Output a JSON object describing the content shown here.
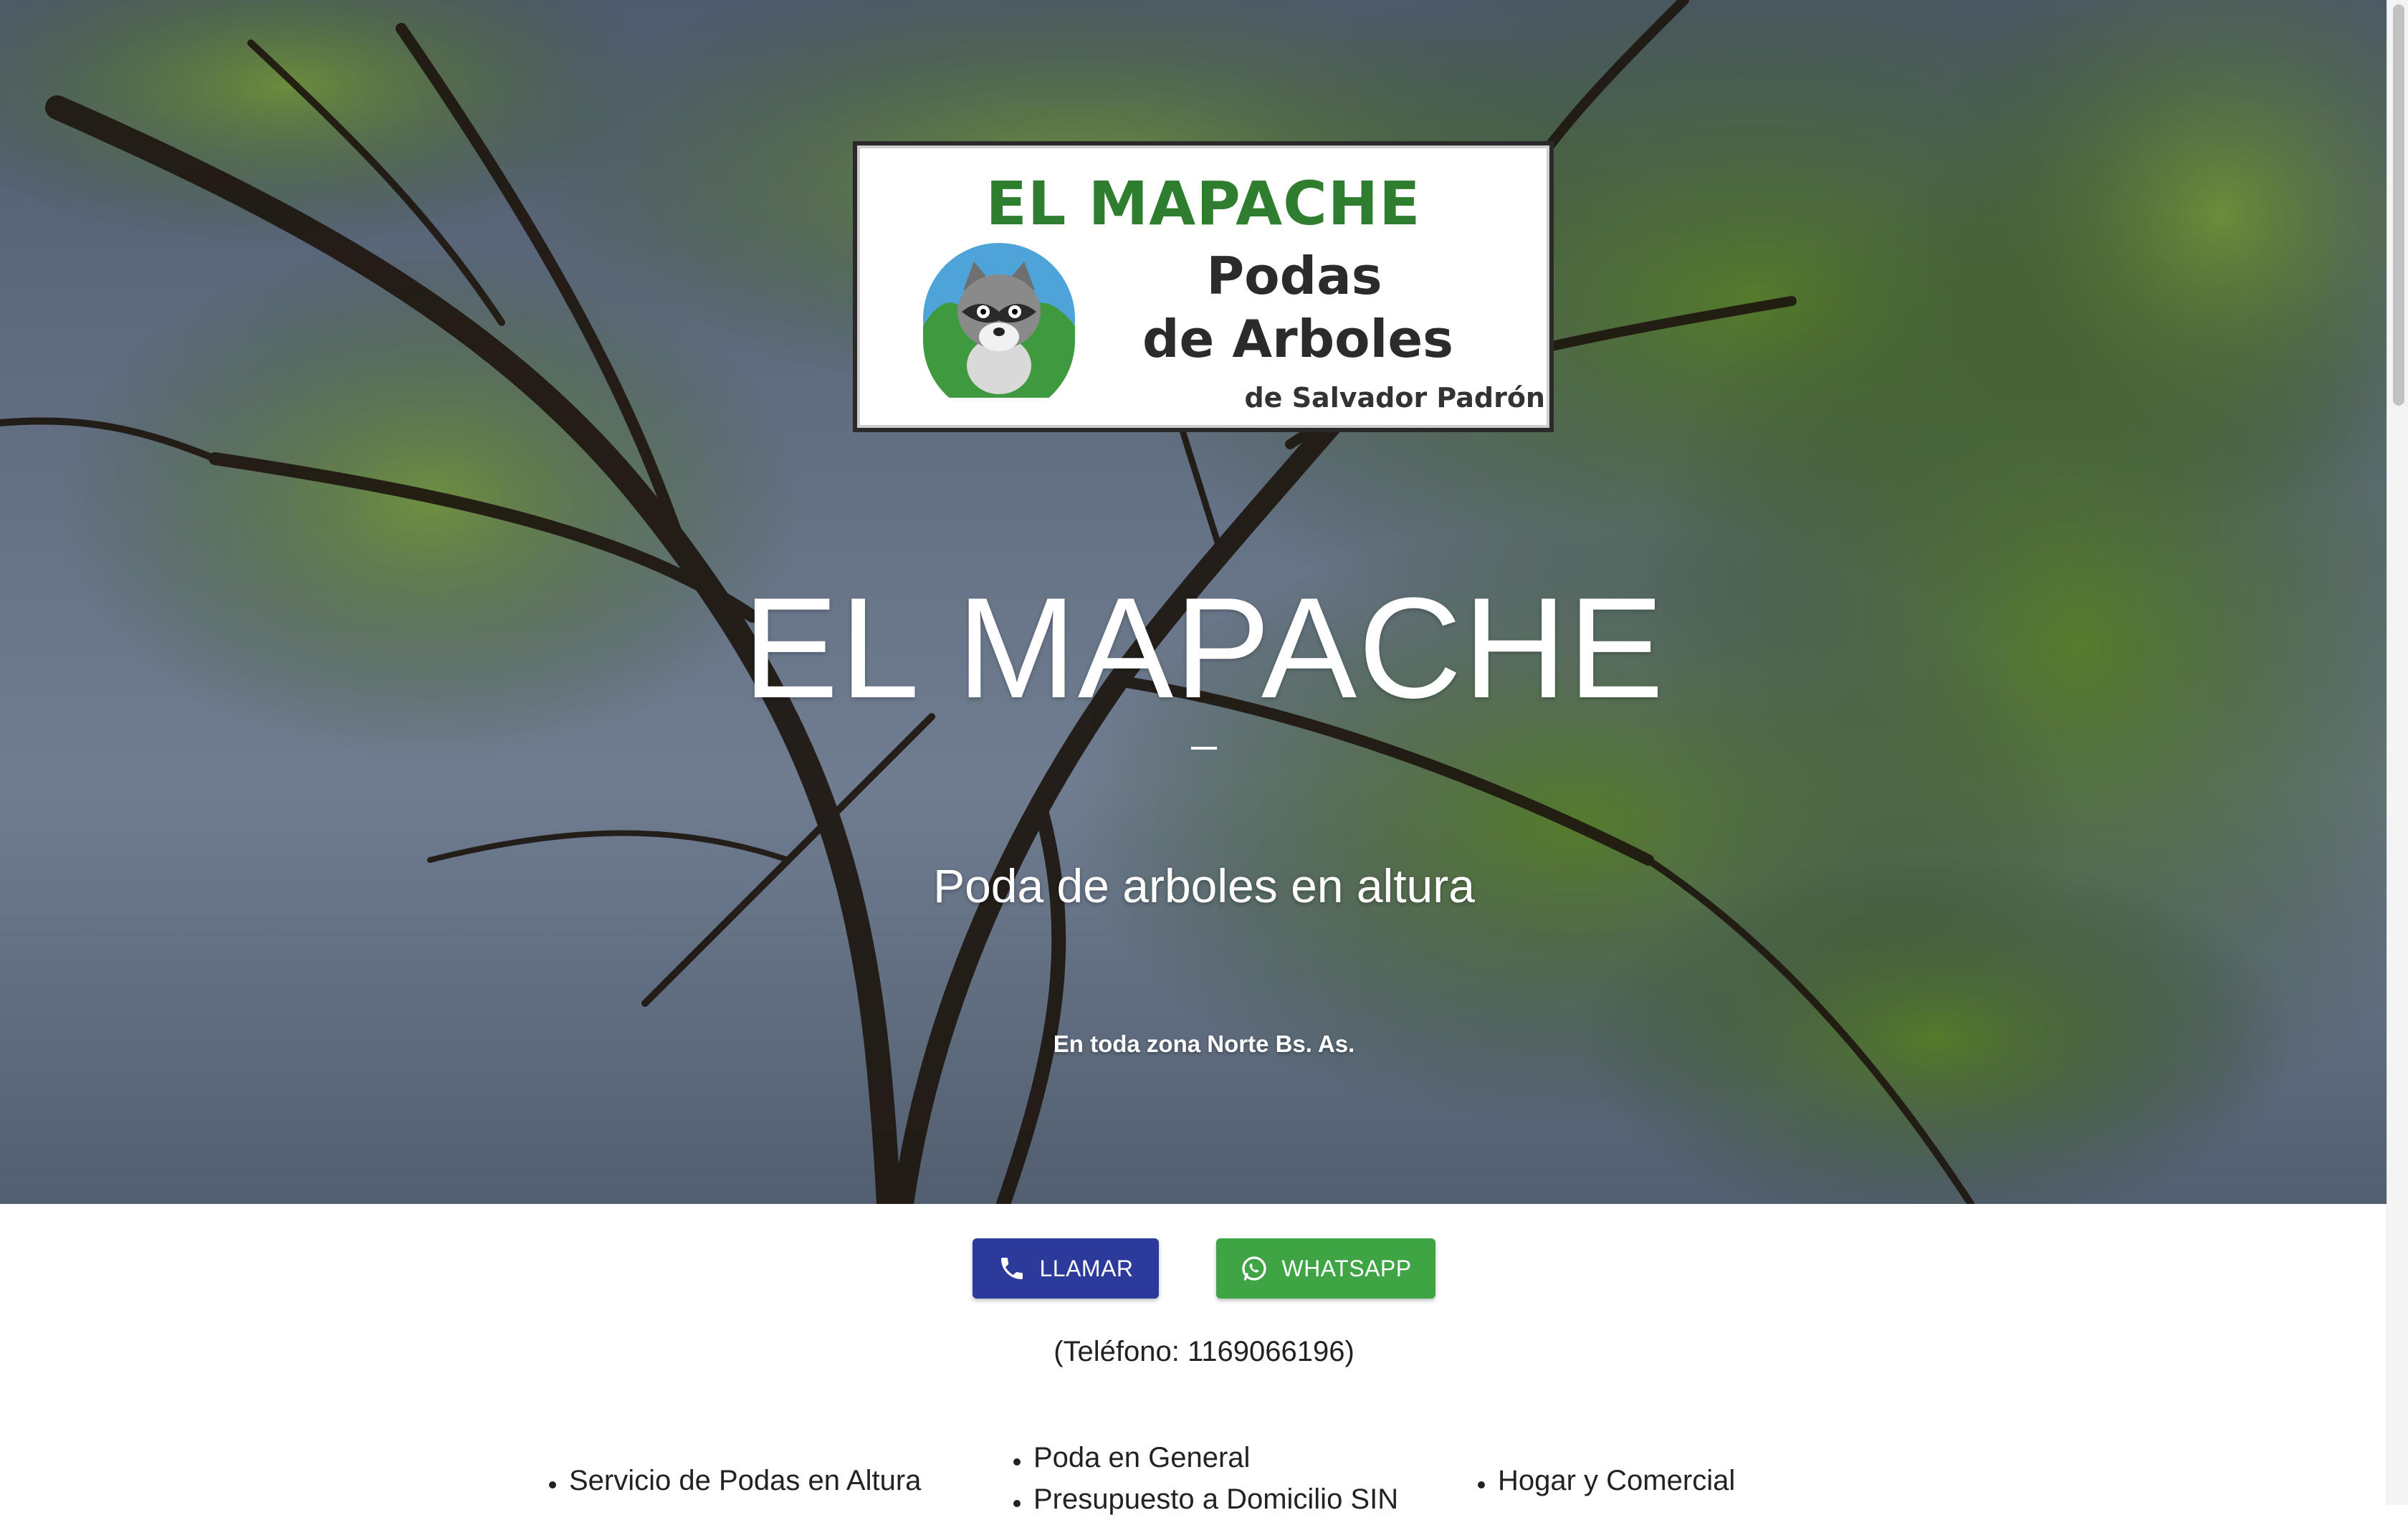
{
  "hero": {
    "logo": {
      "title": "EL MAPACHE",
      "line1": "Podas",
      "line2": "de Arboles",
      "credit": "de Salvador Padrón"
    },
    "title": "EL MAPACHE",
    "subtitle": "Poda de arboles en altura",
    "zone": "En toda zona Norte Bs. As."
  },
  "actions": {
    "call_label": "LLAMAR",
    "whatsapp_label": "WHATSAPP",
    "call_color": "#2c3a9c",
    "whatsapp_color": "#3ea444"
  },
  "phone_text": "(Teléfono: 1169066196)",
  "services": {
    "col1": [
      "Servicio de Podas en Altura"
    ],
    "col2": [
      "Poda en General",
      "Presupuesto a Domicilio SIN"
    ],
    "col3": [
      "Hogar y Comercial"
    ]
  },
  "icons": {
    "call": "phone-icon",
    "whatsapp": "whatsapp-icon"
  }
}
